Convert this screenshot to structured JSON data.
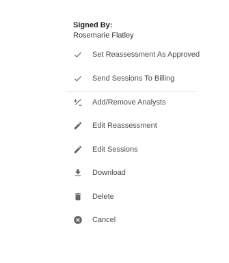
{
  "signature": {
    "label": "Signed By:",
    "name": "Rosemarie Flatley"
  },
  "menu": {
    "items": [
      {
        "label": "Set Reassessment As Approved",
        "icon": "check-icon"
      },
      {
        "label": "Send Sessions To Billing",
        "icon": "check-icon"
      },
      {
        "label": "Add/Remove Analysts",
        "icon": "plus-minus-icon"
      },
      {
        "label": "Edit Reassessment",
        "icon": "pencil-icon"
      },
      {
        "label": "Edit Sessions",
        "icon": "pencil-icon"
      },
      {
        "label": "Download",
        "icon": "download-icon"
      },
      {
        "label": "Delete",
        "icon": "trash-icon"
      },
      {
        "label": "Cancel",
        "icon": "cancel-circle-icon"
      }
    ]
  },
  "colors": {
    "icon": "#666666",
    "text": "#4a4a4a",
    "divider": "#e6e6e6"
  }
}
